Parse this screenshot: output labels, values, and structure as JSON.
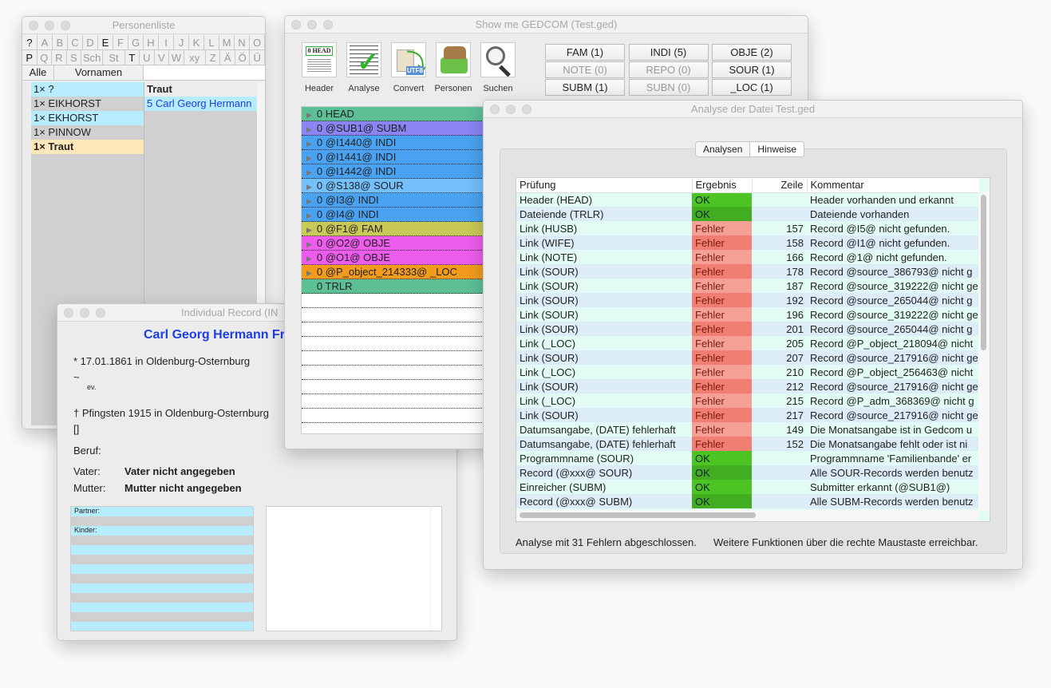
{
  "personenliste": {
    "title": "Personenliste",
    "alpha_row1": [
      "?",
      "A",
      "B",
      "C",
      "D",
      "E",
      "F",
      "G",
      "H",
      "I",
      "J",
      "K",
      "L",
      "M",
      "N",
      "O"
    ],
    "alpha_row2": [
      "P",
      "Q",
      "R",
      "S",
      "Sch",
      "St",
      "T",
      "U",
      "V",
      "W",
      "xy",
      "Z",
      "Ä",
      "Ö",
      "Ü"
    ],
    "bold_row1": [
      "?",
      "E"
    ],
    "bold_row2": [
      "P",
      "T"
    ],
    "tab_all": "Alle",
    "tab_firstnames": "Vornamen",
    "surnames": [
      {
        "label": "1× ?",
        "color": "#b6ecfb"
      },
      {
        "label": "1× EIKHORST",
        "color": "#d0d0d0"
      },
      {
        "label": "1× EKHORST",
        "color": "#b6ecfb"
      },
      {
        "label": "1× PINNOW",
        "color": "#d0d0d0"
      },
      {
        "label": "1× Traut",
        "color": "#fde6b8",
        "selected": true
      }
    ],
    "selected_surname": "Traut",
    "persons": [
      {
        "label": "5  Carl Georg Hermann"
      }
    ]
  },
  "gedcom": {
    "title": "Show me GEDCOM (Test.ged)",
    "tools": [
      {
        "label": "Header",
        "icon": "header-doc-icon"
      },
      {
        "label": "Analyse",
        "icon": "analyse-check-icon"
      },
      {
        "label": "Convert",
        "icon": "convert-utf8-icon"
      },
      {
        "label": "Personen",
        "icon": "persons-icon"
      },
      {
        "label": "Suchen",
        "icon": "magnifier-icon"
      }
    ],
    "counts": [
      {
        "label": "FAM (1)",
        "enabled": true
      },
      {
        "label": "INDI (5)",
        "enabled": true
      },
      {
        "label": "OBJE (2)",
        "enabled": true
      },
      {
        "label": "NOTE (0)",
        "enabled": false
      },
      {
        "label": "REPO (0)",
        "enabled": false
      },
      {
        "label": "SOUR (1)",
        "enabled": true
      },
      {
        "label": "SUBM (1)",
        "enabled": true
      },
      {
        "label": "SUBN (0)",
        "enabled": false
      },
      {
        "label": "_LOC (1)",
        "enabled": true
      }
    ],
    "records": [
      {
        "label": "0 HEAD",
        "color": "#5dbf96",
        "expandable": true
      },
      {
        "label": "0 @SUB1@ SUBM",
        "color": "#8a84f5",
        "expandable": true
      },
      {
        "label": "0 @I1440@ INDI",
        "color": "#4aa3f2",
        "expandable": true
      },
      {
        "label": "0 @I1441@ INDI",
        "color": "#4aa3f2",
        "expandable": true
      },
      {
        "label": "0 @I1442@ INDI",
        "color": "#4aa3f2",
        "expandable": true
      },
      {
        "label": "0 @S138@ SOUR",
        "color": "#73c0fb",
        "expandable": true
      },
      {
        "label": "0 @I3@ INDI",
        "color": "#4aa3f2",
        "expandable": true
      },
      {
        "label": "0 @I4@ INDI",
        "color": "#4aa3f2",
        "expandable": true
      },
      {
        "label": "0 @F1@ FAM",
        "color": "#c9c957",
        "expandable": true
      },
      {
        "label": "0 @O2@ OBJE",
        "color": "#ee5cee",
        "expandable": true
      },
      {
        "label": "0 @O1@ OBJE",
        "color": "#ee5cee",
        "expandable": true
      },
      {
        "label": "0 @P_object_214333@ _LOC",
        "color": "#f39b1d",
        "expandable": true
      },
      {
        "label": "0 TRLR",
        "color": "#5dbf96",
        "expandable": false
      }
    ]
  },
  "individual": {
    "title": "Individual Record  (IN",
    "name": "Carl Georg Hermann Fr",
    "birth": "* 17.01.1861 in Oldenburg-Osternburg",
    "baptism": "~",
    "religion": "ev.",
    "death": "† Pfingsten 1915 in Oldenburg-Osternburg",
    "burial": "[]",
    "occupation_label": "Beruf:",
    "father_label": "Vater:",
    "father": "Vater nicht angegeben",
    "mother_label": "Mutter:",
    "mother": "Mutter nicht angegeben",
    "partner_label": "Partner:",
    "children_label": "Kinder:"
  },
  "analyse": {
    "title": "Analyse der Datei Test.ged",
    "tabs": [
      {
        "label": "Analysen",
        "active": false
      },
      {
        "label": "Hinweise",
        "active": true
      }
    ],
    "columns": [
      "Prüfung",
      "Ergebnis",
      "Zeile",
      "Kommentar"
    ],
    "rows": [
      [
        "Header (HEAD)",
        "OK",
        "",
        "Header vorhanden und erkannt"
      ],
      [
        "Dateiende (TRLR)",
        "OK",
        "",
        "Dateiende vorhanden"
      ],
      [
        "Link (HUSB)",
        "Fehler",
        "157",
        "Record @I5@ nicht gefunden."
      ],
      [
        "Link (WIFE)",
        "Fehler",
        "158",
        "Record @I1@ nicht gefunden."
      ],
      [
        "Link (NOTE)",
        "Fehler",
        "166",
        "Record @1@ nicht gefunden."
      ],
      [
        "Link (SOUR)",
        "Fehler",
        "178",
        "Record @source_386793@ nicht g"
      ],
      [
        "Link (SOUR)",
        "Fehler",
        "187",
        "Record @source_319222@ nicht ge"
      ],
      [
        "Link (SOUR)",
        "Fehler",
        "192",
        "Record @source_265044@ nicht g"
      ],
      [
        "Link (SOUR)",
        "Fehler",
        "196",
        "Record @source_319222@ nicht ge"
      ],
      [
        "Link (SOUR)",
        "Fehler",
        "201",
        "Record @source_265044@ nicht g"
      ],
      [
        "Link (_LOC)",
        "Fehler",
        "205",
        "Record @P_object_218094@ nicht"
      ],
      [
        "Link (SOUR)",
        "Fehler",
        "207",
        "Record @source_217916@ nicht ge"
      ],
      [
        "Link (_LOC)",
        "Fehler",
        "210",
        "Record @P_object_256463@ nicht"
      ],
      [
        "Link (SOUR)",
        "Fehler",
        "212",
        "Record @source_217916@ nicht ge"
      ],
      [
        "Link (_LOC)",
        "Fehler",
        "215",
        "Record @P_adm_368369@ nicht g"
      ],
      [
        "Link (SOUR)",
        "Fehler",
        "217",
        "Record @source_217916@ nicht ge"
      ],
      [
        "Datumsangabe, (DATE) fehlerhaft",
        "Fehler",
        "149",
        "Die Monatsangabe ist in Gedcom u"
      ],
      [
        "Datumsangabe, (DATE) fehlerhaft",
        "Fehler",
        "152",
        "Die Monatsangabe fehlt oder ist ni"
      ],
      [
        "Programmname (SOUR)",
        "OK",
        "",
        "Programmname 'Familienbande' er"
      ],
      [
        "Record (@xxx@ SOUR)",
        "OK",
        "",
        "Alle SOUR-Records werden benutz"
      ],
      [
        "Einreicher (SUBM)",
        "OK",
        "",
        "Submitter erkannt (@SUB1@)"
      ],
      [
        "Record (@xxx@ SUBM)",
        "OK",
        "",
        "Alle SUBM-Records werden benutz"
      ]
    ],
    "status_left": "Analyse mit 31 Fehlern abgeschlossen.",
    "status_right": "Weitere Funktionen über die rechte Maustaste erreichbar.",
    "colors": {
      "ok": "#4cc424",
      "ok_alt": "#43ad22",
      "error": "#f4a097",
      "error_alt": "#f07e72",
      "row": "#e2fbf5",
      "row_alt": "#dcedf7"
    }
  }
}
